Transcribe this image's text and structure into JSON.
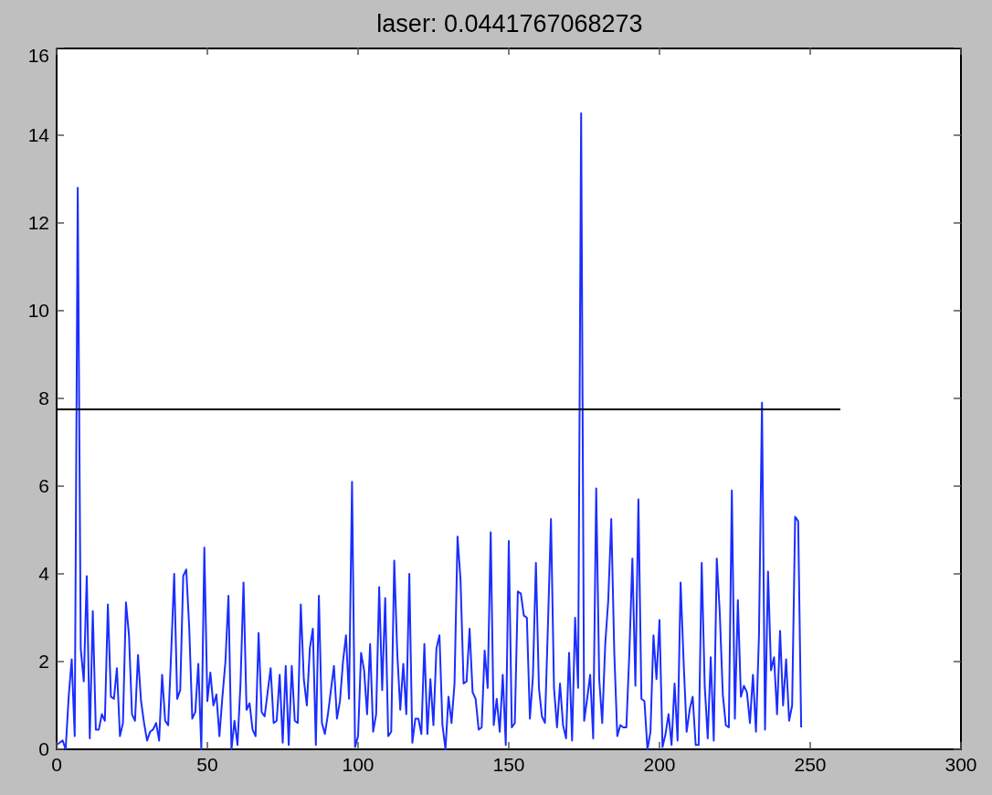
{
  "figure": {
    "chart_data": {
      "type": "line",
      "title": "laser: 0.0441767068273",
      "xlim": [
        0,
        300
      ],
      "ylim": [
        0,
        16
      ],
      "xticks": [
        0,
        50,
        100,
        150,
        200,
        250,
        300
      ],
      "yticks": [
        0,
        2,
        4,
        6,
        8,
        10,
        12,
        14,
        16
      ],
      "x": [
        0,
        1,
        2,
        3,
        4,
        5,
        6,
        7,
        8,
        9,
        10,
        11,
        12,
        13,
        14,
        15,
        16,
        17,
        18,
        19,
        20,
        21,
        22,
        23,
        24,
        25,
        26,
        27,
        28,
        29,
        30,
        31,
        32,
        33,
        34,
        35,
        36,
        37,
        38,
        39,
        40,
        41,
        42,
        43,
        44,
        45,
        46,
        47,
        48,
        49,
        50,
        51,
        52,
        53,
        54,
        55,
        56,
        57,
        58,
        59,
        60,
        61,
        62,
        63,
        64,
        65,
        66,
        67,
        68,
        69,
        70,
        71,
        72,
        73,
        74,
        75,
        76,
        77,
        78,
        79,
        80,
        81,
        82,
        83,
        84,
        85,
        86,
        87,
        88,
        89,
        90,
        91,
        92,
        93,
        94,
        95,
        96,
        97,
        98,
        99,
        100,
        101,
        102,
        103,
        104,
        105,
        106,
        107,
        108,
        109,
        110,
        111,
        112,
        113,
        114,
        115,
        116,
        117,
        118,
        119,
        120,
        121,
        122,
        123,
        124,
        125,
        126,
        127,
        128,
        129,
        130,
        131,
        132,
        133,
        134,
        135,
        136,
        137,
        138,
        139,
        140,
        141,
        142,
        143,
        144,
        145,
        146,
        147,
        148,
        149,
        150,
        151,
        152,
        153,
        154,
        155,
        156,
        157,
        158,
        159,
        160,
        161,
        162,
        163,
        164,
        165,
        166,
        167,
        168,
        169,
        170,
        171,
        172,
        173,
        174,
        175,
        176,
        177,
        178,
        179,
        180,
        181,
        182,
        183,
        184,
        185,
        186,
        187,
        188,
        189,
        190,
        191,
        192,
        193,
        194,
        195,
        196,
        197,
        198,
        199,
        200,
        201,
        202,
        203,
        204,
        205,
        206,
        207,
        208,
        209,
        210,
        211,
        212,
        213,
        214,
        215,
        216,
        217,
        218,
        219,
        220,
        221,
        222,
        223,
        224,
        225,
        226,
        227,
        228,
        229,
        230,
        231,
        232,
        233,
        234,
        235,
        236,
        237,
        238,
        239,
        240,
        241,
        242,
        243,
        244,
        245,
        246,
        247,
        260
      ],
      "series": [
        {
          "color": "#1a2eff",
          "values": [
            0.1,
            0.15,
            0.2,
            0,
            1.2,
            2.05,
            0.3,
            12.8,
            2.3,
            1.55,
            3.95,
            0.25,
            3.15,
            0.45,
            0.45,
            0.8,
            0.65,
            3.3,
            1.2,
            1.15,
            1.85,
            0.3,
            0.6,
            3.35,
            2.6,
            0.8,
            0.65,
            2.15,
            1.1,
            0.6,
            0.2,
            0.4,
            0.45,
            0.6,
            0.2,
            1.7,
            0.65,
            0.55,
            2.2,
            4.0,
            1.15,
            1.35,
            3.95,
            4.1,
            2.75,
            0.7,
            0.85,
            1.95,
            0,
            4.6,
            1.1,
            1.75,
            1.0,
            1.25,
            0.3,
            1.2,
            2.0,
            3.5,
            0,
            0.65,
            0.1,
            1.5,
            3.8,
            0.9,
            1.05,
            0.45,
            0.3,
            2.65,
            0.85,
            0.75,
            1.3,
            1.85,
            0.6,
            0.65,
            1.7,
            0.15,
            1.9,
            0.1,
            1.9,
            0.65,
            0.6,
            3.3,
            1.6,
            1.0,
            2.3,
            2.75,
            0.1,
            3.5,
            0.6,
            0.35,
            0.8,
            1.35,
            1.9,
            0.7,
            1.1,
            2.0,
            2.6,
            1.15,
            6.1,
            0.05,
            0.3,
            2.2,
            1.8,
            0.8,
            2.4,
            0.4,
            0.8,
            3.7,
            1.35,
            3.45,
            0.3,
            0.4,
            4.3,
            2.2,
            0.9,
            1.95,
            0.8,
            4.0,
            0.15,
            0.7,
            0.7,
            0.35,
            2.4,
            0.35,
            1.6,
            0.55,
            2.3,
            2.6,
            0.55,
            0,
            1.2,
            0.6,
            1.5,
            4.85,
            3.85,
            1.5,
            1.55,
            2.75,
            1.3,
            1.15,
            0.45,
            0.5,
            2.25,
            1.4,
            4.95,
            0.55,
            1.15,
            0.4,
            1.7,
            0.1,
            4.75,
            0.5,
            0.6,
            3.6,
            3.55,
            3.05,
            3.0,
            0.7,
            1.65,
            4.25,
            1.4,
            0.75,
            0.6,
            2.85,
            5.25,
            1.4,
            0.5,
            1.5,
            0.55,
            0.25,
            2.2,
            0.2,
            3.0,
            1.4,
            14.5,
            0.65,
            1.15,
            1.7,
            0.25,
            5.95,
            1.6,
            0.6,
            2.4,
            3.4,
            5.25,
            2.2,
            0.3,
            0.55,
            0.5,
            0.5,
            2.2,
            4.35,
            1.45,
            5.7,
            1.15,
            1.1,
            0,
            0.4,
            2.6,
            1.6,
            2.95,
            0.05,
            0.35,
            0.8,
            0.1,
            1.5,
            0.2,
            3.8,
            2.0,
            0.4,
            0.9,
            1.2,
            0.1,
            0.1,
            4.25,
            1.45,
            0.25,
            2.1,
            0.2,
            4.35,
            3.1,
            1.25,
            0.55,
            0.5,
            5.9,
            0.7,
            3.4,
            1.2,
            1.45,
            1.3,
            0.6,
            1.7,
            0.4,
            2.6,
            7.9,
            0.45,
            4.05,
            1.8,
            2.1,
            0.8,
            2.7,
            1.0,
            2.05,
            0.65,
            1.0,
            5.3,
            5.2,
            0.5,
            null
          ]
        },
        {
          "color": "#000000",
          "values": [
            7.75,
            7.75,
            7.75,
            7.75,
            7.75,
            7.75,
            7.75,
            7.75,
            7.75,
            7.75,
            7.75,
            7.75,
            7.75,
            7.75,
            7.75,
            7.75,
            7.75,
            7.75,
            7.75,
            7.75,
            7.75,
            7.75,
            7.75,
            7.75,
            7.75,
            7.75,
            7.75,
            7.75,
            7.75,
            7.75,
            7.75,
            7.75,
            7.75,
            7.75,
            7.75,
            7.75,
            7.75,
            7.75,
            7.75,
            7.75,
            7.75,
            7.75,
            7.75,
            7.75,
            7.75,
            7.75,
            7.75,
            7.75,
            7.75,
            7.75,
            7.75,
            7.75,
            7.75,
            7.75,
            7.75,
            7.75,
            7.75,
            7.75,
            7.75,
            7.75,
            7.75,
            7.75,
            7.75,
            7.75,
            7.75,
            7.75,
            7.75,
            7.75,
            7.75,
            7.75,
            7.75,
            7.75,
            7.75,
            7.75,
            7.75,
            7.75,
            7.75,
            7.75,
            7.75,
            7.75,
            7.75,
            7.75,
            7.75,
            7.75,
            7.75,
            7.75,
            7.75,
            7.75,
            7.75,
            7.75,
            7.75,
            7.75,
            7.75,
            7.75,
            7.75,
            7.75,
            7.75,
            7.75,
            7.75,
            7.75,
            7.75,
            7.75,
            7.75,
            7.75,
            7.75,
            7.75,
            7.75,
            7.75,
            7.75,
            7.75,
            7.75,
            7.75,
            7.75,
            7.75,
            7.75,
            7.75,
            7.75,
            7.75,
            7.75,
            7.75,
            7.75,
            7.75,
            7.75,
            7.75,
            7.75,
            7.75,
            7.75,
            7.75,
            7.75,
            7.75,
            7.75,
            7.75,
            7.75,
            7.75,
            7.75,
            7.75,
            7.75,
            7.75,
            7.75,
            7.75,
            7.75,
            7.75,
            7.75,
            7.75,
            7.75,
            7.75,
            7.75,
            7.75,
            7.75,
            7.75,
            7.75,
            7.75,
            7.75,
            7.75,
            7.75,
            7.75,
            7.75,
            7.75,
            7.75,
            7.75,
            7.75,
            7.75,
            7.75,
            7.75,
            7.75,
            7.75,
            7.75,
            7.75,
            7.75,
            7.75,
            7.75,
            7.75,
            7.75,
            7.75,
            7.75,
            7.75,
            7.75,
            7.75,
            7.75,
            7.75,
            7.75,
            7.75,
            7.75,
            7.75,
            7.75,
            7.75,
            7.75,
            7.75,
            7.75,
            7.75,
            7.75,
            7.75,
            7.75,
            7.75,
            7.75,
            7.75,
            7.75,
            7.75,
            7.75,
            7.75,
            7.75,
            7.75,
            7.75,
            7.75,
            7.75,
            7.75,
            7.75,
            7.75,
            7.75,
            7.75,
            7.75,
            7.75,
            7.75,
            7.75,
            7.75,
            7.75,
            7.75,
            7.75,
            7.75,
            7.75,
            7.75,
            7.75,
            7.75,
            7.75,
            7.75,
            7.75,
            7.75,
            7.75,
            7.75,
            7.75,
            7.75,
            7.75,
            7.75,
            7.75,
            7.75,
            7.75,
            7.75,
            7.75,
            7.75,
            7.75,
            7.75,
            7.75,
            7.75,
            7.75,
            7.75,
            7.75,
            7.75,
            7.75,
            7.75
          ]
        }
      ]
    }
  }
}
